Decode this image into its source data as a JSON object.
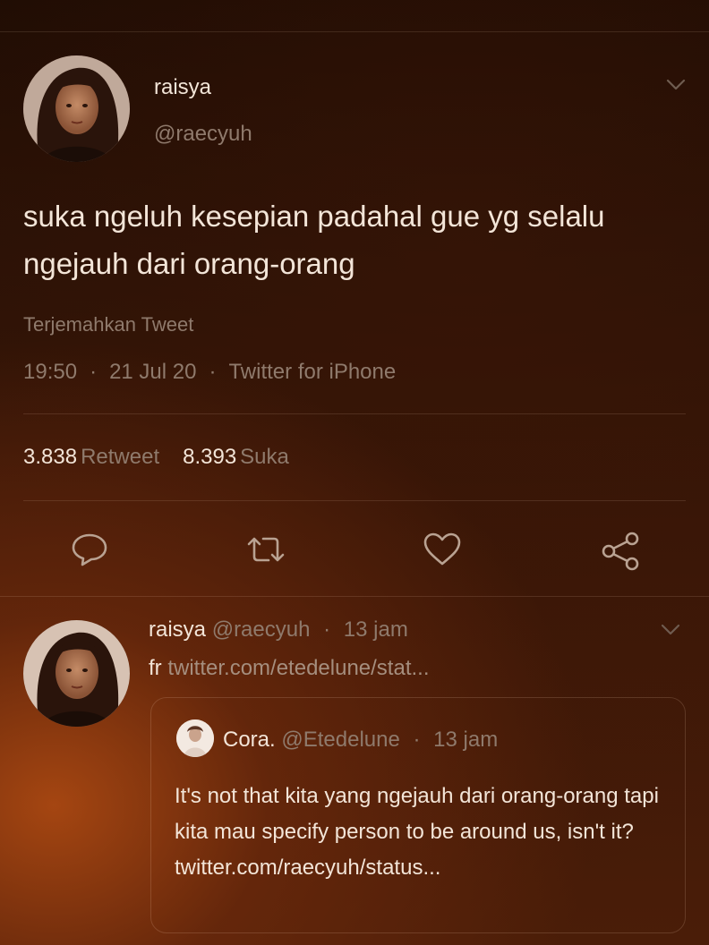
{
  "tweet": {
    "author_name": "raisya",
    "author_handle": "@raecyuh",
    "text": "suka ngeluh kesepian padahal gue yg selalu ngejauh dari orang-orang",
    "translate_label": "Terjemahkan Tweet",
    "time": "19:50",
    "separator": "·",
    "date": "21 Jul 20",
    "source": "Twitter for iPhone",
    "retweet_count": "3.838",
    "retweet_label": "Retweet",
    "like_count": "8.393",
    "like_label": "Suka"
  },
  "actions": {
    "reply_icon": "reply-icon",
    "retweet_icon": "retweet-icon",
    "like_icon": "heart-icon",
    "share_icon": "share-icon"
  },
  "reply": {
    "author_name": "raisya",
    "author_handle": "@raecyuh",
    "separator": "·",
    "time": "13 jam",
    "prefix": "fr",
    "link": "twitter.com/etedelune/stat...",
    "quote": {
      "author_name": "Cora.",
      "author_handle": "@Etedelune",
      "separator": "·",
      "time": "13 jam",
      "text": "It's not that kita yang ngejauh dari orang-orang tapi kita mau specify person to be around us, isn't it? twitter.com/raecyuh/status..."
    }
  },
  "colors": {
    "text_primary": "#f3e5d8",
    "text_muted": "#8f7a6c",
    "background": "#2c1206"
  }
}
